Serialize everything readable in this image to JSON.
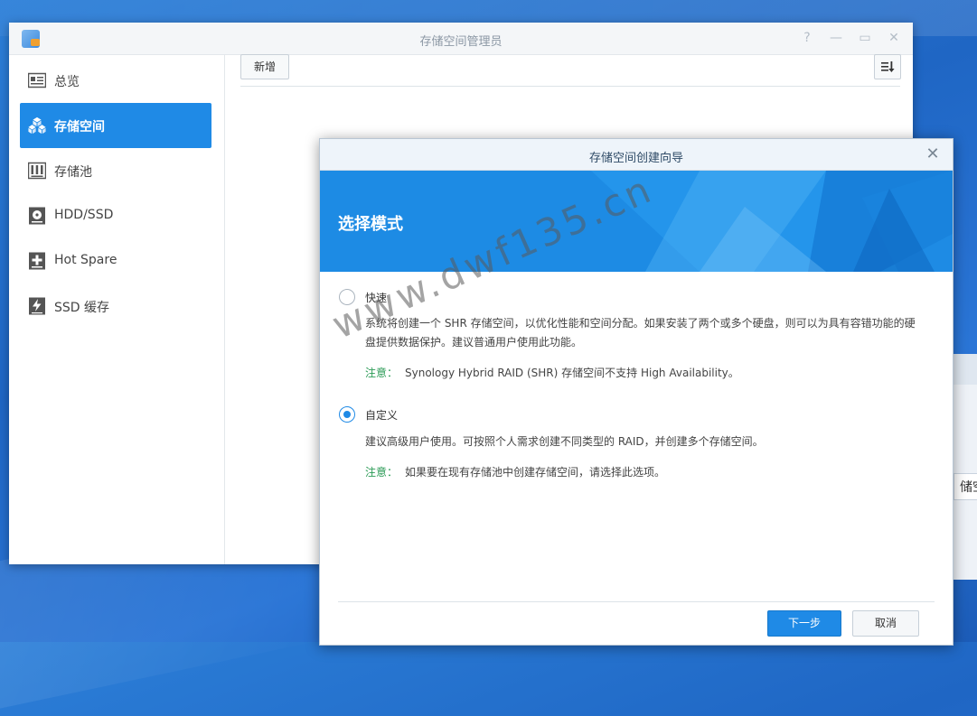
{
  "window": {
    "title": "存储空间管理员",
    "controls": {
      "help": "?",
      "minimize": "—",
      "maximize": "▭",
      "close": "✕"
    }
  },
  "sidebar": {
    "items": [
      {
        "label": "总览",
        "icon": "overview-icon",
        "active": false
      },
      {
        "label": "存储空间",
        "icon": "volume-icon",
        "active": true
      },
      {
        "label": "存储池",
        "icon": "storage-pool-icon",
        "active": false
      },
      {
        "label": "HDD/SSD",
        "icon": "disk-icon",
        "active": false
      },
      {
        "label": "Hot Spare",
        "icon": "hot-spare-icon",
        "active": false
      },
      {
        "label": "SSD 缓存",
        "icon": "ssd-cache-icon",
        "active": false
      }
    ]
  },
  "toolbar": {
    "add_label": "新增",
    "sort_icon": "sort-icon"
  },
  "background_window": {
    "partial_text": "储空间"
  },
  "wizard": {
    "title": "存储空间创建向导",
    "close": "✕",
    "banner_title": "选择模式",
    "options": [
      {
        "label": "快速",
        "checked": false,
        "desc_line1": "系统将创建一个 SHR 存储空间，以优化性能和空间分配。如果安装了两个或多个硬盘，则可以为具有容错功能的硬",
        "desc_line2": "盘提供数据保护。建议普通用户使用此功能。",
        "note_key": "注意：",
        "note_text": "Synology Hybrid RAID (SHR) 存储空间不支持 High Availability。"
      },
      {
        "label": "自定义",
        "checked": true,
        "desc_line1": "建议高级用户使用。可按照个人需求创建不同类型的 RAID，并创建多个存储空间。",
        "note_key": "注意：",
        "note_text": "如果要在现有存储池中创建存储空间，请选择此选项。"
      }
    ],
    "next_label": "下一步",
    "cancel_label": "取消"
  },
  "watermark": "www.dwf135.cn",
  "colors": {
    "accent": "#1f8ae6",
    "note_green": "#2a9a55",
    "desktop": "#2272cc"
  }
}
